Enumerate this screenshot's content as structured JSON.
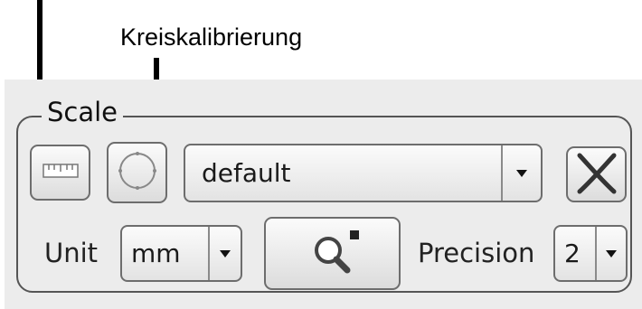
{
  "annotation": {
    "label": "Kreiskalibrierung"
  },
  "scale_group": {
    "title": "Scale",
    "buttons": {
      "ruler_icon": "ruler-icon",
      "circle_icon": "circle-calibration-icon",
      "close_icon": "x-icon",
      "magnifier_icon": "magnifier-icon"
    },
    "profile_select": {
      "value": "default"
    },
    "unit": {
      "label": "Unit",
      "value": "mm"
    },
    "precision": {
      "label": "Precision",
      "value": "2"
    }
  }
}
